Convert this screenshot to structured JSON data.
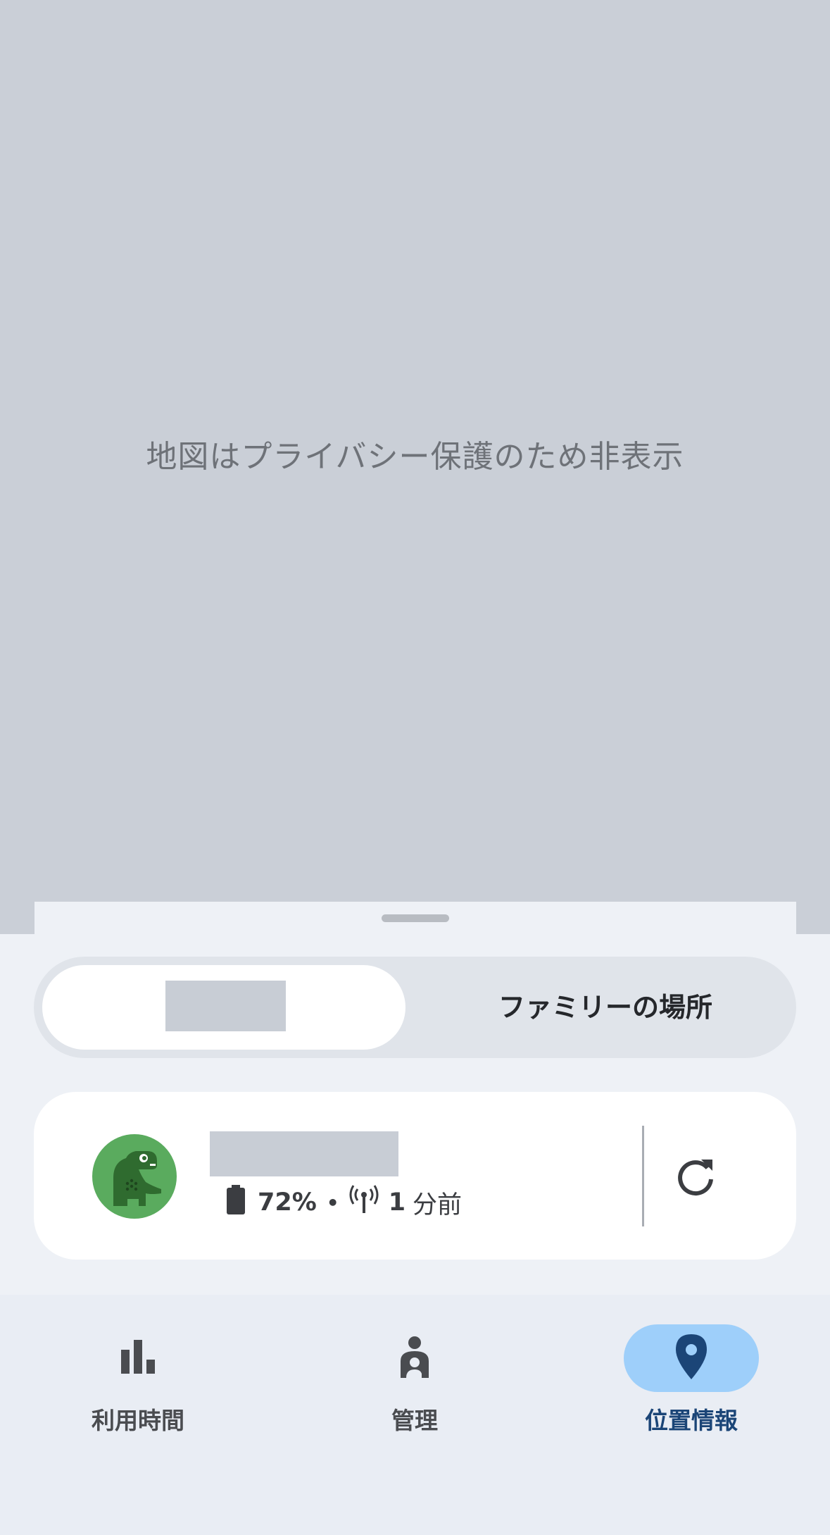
{
  "map": {
    "privacy_text": "地図はプライバシー保護のため非表示"
  },
  "segment": {
    "selected_label": "",
    "other_label": "ファミリーの場所"
  },
  "device": {
    "name": "",
    "battery": "72%",
    "separator": "•",
    "last_seen_num": "1",
    "last_seen_unit": "分前",
    "icons": {
      "avatar": "dinosaur-avatar-icon",
      "battery": "battery-icon",
      "signal": "signal-icon",
      "refresh": "refresh-icon"
    }
  },
  "nav": {
    "items": [
      {
        "label": "利用時間",
        "icon": "bar-chart-icon",
        "active": false
      },
      {
        "label": "管理",
        "icon": "family-person-icon",
        "active": false
      },
      {
        "label": "位置情報",
        "icon": "location-pin-icon",
        "active": true
      }
    ]
  },
  "colors": {
    "map_bg": "#cacfd7",
    "sheet_bg": "#eef1f6",
    "active_pill": "#9ecffa",
    "active_text": "#1b4577",
    "avatar_green": "#5aab5e"
  }
}
